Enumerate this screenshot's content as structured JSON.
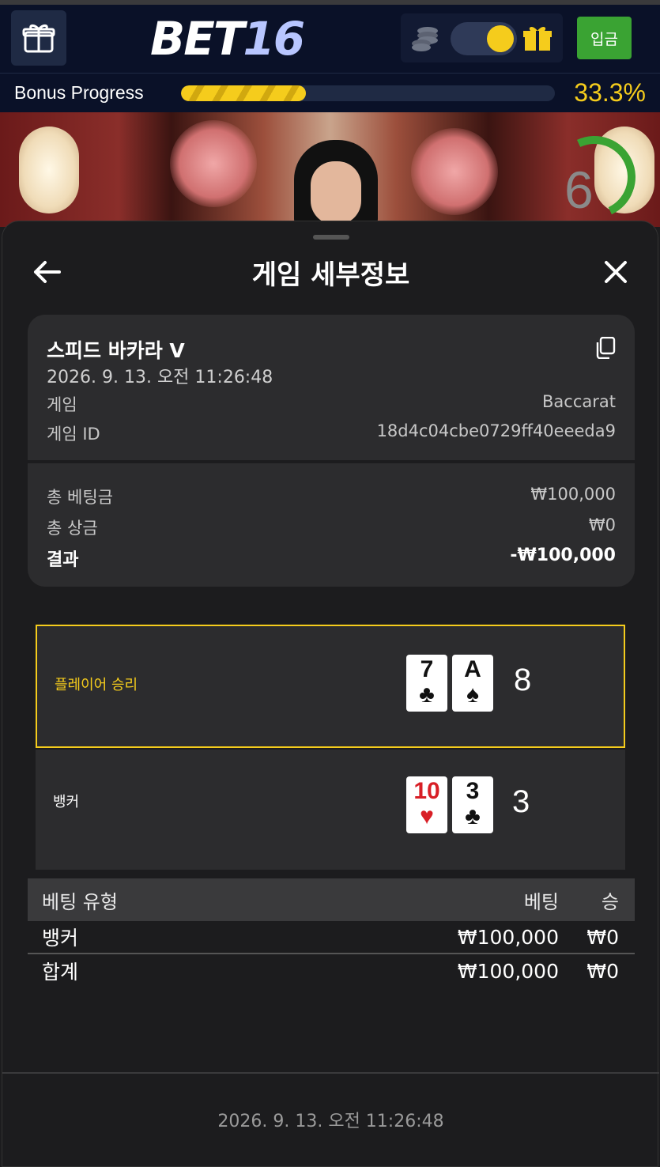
{
  "header": {
    "logo_main": "BET",
    "logo_num": "16",
    "deposit_label": "입금"
  },
  "bonus": {
    "label": "Bonus Progress",
    "percent_text": "33.3%",
    "progress": 0.333
  },
  "video": {
    "timer": "6"
  },
  "sheet": {
    "title": "게임 세부정보"
  },
  "game": {
    "name": "스피드 바카라 V",
    "datetime": "2026. 9. 13. 오전 11:26:48",
    "game_label": "게임",
    "game_value": "Baccarat",
    "id_label": "게임 ID",
    "id_value": "18d4c04cbe0729ff40eeeda9",
    "total_bet_label": "총 베팅금",
    "total_bet_value": "₩100,000",
    "total_prize_label": "총 상금",
    "total_prize_value": "₩0",
    "result_label": "결과",
    "result_value": "-₩100,000"
  },
  "hands": {
    "player": {
      "label": "플레이어 승리",
      "cards": [
        {
          "rank": "7",
          "suit": "♣",
          "color": "black"
        },
        {
          "rank": "A",
          "suit": "♠",
          "color": "black"
        }
      ],
      "total": "8"
    },
    "banker": {
      "label": "뱅커",
      "cards": [
        {
          "rank": "10",
          "suit": "♥",
          "color": "red"
        },
        {
          "rank": "3",
          "suit": "♣",
          "color": "black"
        }
      ],
      "total": "3"
    }
  },
  "bets": {
    "headers": {
      "type": "베팅 유형",
      "bet": "베팅",
      "win": "승"
    },
    "rows": [
      {
        "type": "뱅커",
        "bet": "₩100,000",
        "win": "₩0"
      }
    ],
    "total": {
      "type": "합계",
      "bet": "₩100,000",
      "win": "₩0"
    }
  },
  "footer": {
    "datetime": "2026. 9. 13. 오전 11:26:48"
  },
  "colors": {
    "accent_yellow": "#f5cc1c",
    "deposit_green": "#3aa333",
    "header_bg": "#0a1128",
    "panel_bg": "#2c2c2e"
  },
  "icons": [
    "gift-icon",
    "coins-icon",
    "gift-box-icon",
    "back-arrow-icon",
    "close-icon",
    "copy-icon"
  ]
}
